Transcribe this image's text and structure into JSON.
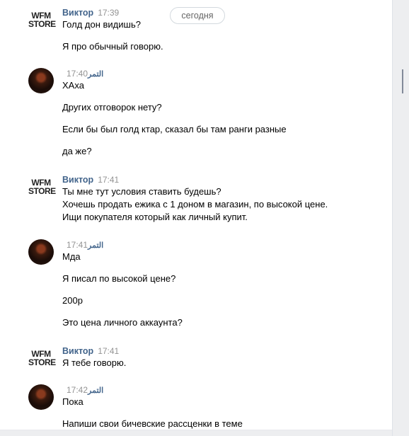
{
  "date_separator": "сегодня",
  "messages": [
    {
      "author": "Виктор",
      "time": "17:39",
      "avatar": "wfm-store-logo",
      "avatar_text": [
        "WFM",
        "STORE"
      ],
      "lines": [
        "Голд дон видишь?",
        "Я про обычный говорю."
      ]
    },
    {
      "author": "التمر",
      "time": "17:40",
      "avatar": "user-photo",
      "lines": [
        "ХАха",
        "Других отговорок нету?",
        "Если бы был голд ктар, сказал бы там ранги разные",
        "да же?"
      ]
    },
    {
      "author": "Виктор",
      "time": "17:41",
      "avatar": "wfm-store-logo",
      "avatar_text": [
        "WFM",
        "STORE"
      ],
      "lines": [
        "Ты мне тут условия ставить будешь?",
        "Хочешь продать ежика с 1 доном в магазин, по высокой цене.",
        "Ищи покупателя который как личный купит."
      ]
    },
    {
      "author": "التمر",
      "time": "17:41",
      "avatar": "user-photo",
      "lines": [
        "Мда",
        "Я писал по высокой цене?",
        "200р",
        "Это цена личного аккаунта?"
      ]
    },
    {
      "author": "Виктор",
      "time": "17:41",
      "avatar": "wfm-store-logo",
      "avatar_text": [
        "WFM",
        "STORE"
      ],
      "lines": [
        "Я тебе говорю."
      ]
    },
    {
      "author": "التمر",
      "time": "17:42",
      "avatar": "user-photo",
      "lines": [
        "Пока",
        "Напиши свои бичевские рассценки в теме"
      ]
    }
  ],
  "colors": {
    "author": "#42648b",
    "time": "#939393",
    "rail": "#edeef0"
  }
}
